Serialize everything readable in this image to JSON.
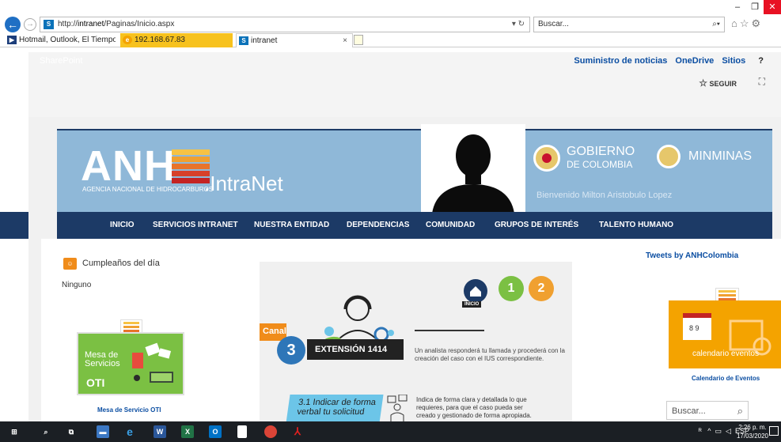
{
  "browser": {
    "url_prefix": "http://",
    "url_host": "intranet",
    "url_path": "/Paginas/Inicio.aspx",
    "url_tools": "▾ ↻",
    "search_placeholder": "Buscar...",
    "window_controls": {
      "minimize": "–",
      "maximize": "❐",
      "close": "✕"
    },
    "tabs": [
      {
        "label": "Hotmail, Outlook, El Tiempo, ..."
      },
      {
        "label": "192.168.67.83"
      },
      {
        "label": "intranet",
        "close": "×"
      }
    ]
  },
  "suitebar": {
    "brand": "SharePoint",
    "links": [
      "Suministro de noticias",
      "OneDrive",
      "Sitios"
    ],
    "help": "?",
    "follow": "SEGUIR"
  },
  "banner": {
    "logo": "ANH",
    "logo_subtitle": "AGENCIA NACIONAL DE HIDROCARBUROS",
    "intranet": ".IntraNet",
    "gov_line1": "GOBIERNO",
    "gov_line2": "DE COLOMBIA",
    "minminas": "MINMINAS",
    "welcome": "Bienvenido Milton Aristobulo Lopez"
  },
  "nav": [
    "INICIO",
    "SERVICIOS INTRANET",
    "NUESTRA ENTIDAD",
    "DEPENDENCIAS",
    "COMUNIDAD",
    "GRUPOS DE INTERÉS",
    "TALENTO HUMANO"
  ],
  "birthdays": {
    "title": "Cumpleaños del día",
    "value": "Ninguno"
  },
  "mesa": {
    "tile_line1": "Mesa de",
    "tile_line2": "Servicios",
    "tile_oti": "OTI",
    "caption": "Mesa de Servicio OTI"
  },
  "poster": {
    "canal": "Canal",
    "canal_num": "3",
    "extension": "EXTENSIÓN 1414",
    "extension_desc": "Un analista responderá tu llamada y procederá con la creación del caso con el IUS correspondiente.",
    "inicio": "INICIO",
    "step1": "1",
    "step2": "2",
    "s31": "3.1 Indicar de forma verbal tu solicitud",
    "s31_desc": "Indica de forma clara y detallada lo que requieres, para que el caso pueda ser creado y gestionado de forma apropiada."
  },
  "right": {
    "tweets": "Tweets by ANHColombia",
    "cal_tile": "calendario eventos",
    "cal_caption": "Calendario de Eventos",
    "search_placeholder": "Buscar..."
  },
  "taskbar": {
    "lang": "ESP",
    "time": "2:26 p. m.",
    "date": "17/03/2020"
  },
  "colors": {
    "nav_bg": "#1c3a66",
    "banner_bg": "#8fb8d8",
    "link": "#0b4ea2",
    "close": "#e81123"
  }
}
